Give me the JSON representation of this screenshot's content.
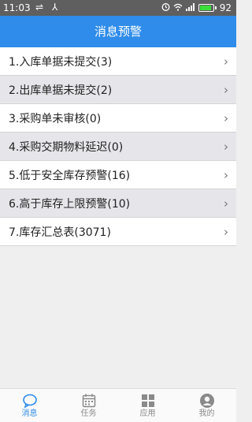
{
  "status_bar": {
    "time": "11:03",
    "battery_level": "92",
    "battery_fill": 0.92,
    "icons": [
      "usb-icon",
      "share-icon",
      "alarm-icon",
      "wifi-icon",
      "signal-icon",
      "battery-icon"
    ]
  },
  "header": {
    "title": "消息预警"
  },
  "messages": [
    "1.入库单据未提交(3)",
    "2.出库单据未提交(2)",
    "3.采购单未审核(0)",
    "4.采购交期物料延迟(0)",
    "5.低于安全库存预警(16)",
    "6.高于库存上限预警(10)",
    "7.库存汇总表(3071)"
  ],
  "tabs": [
    {
      "label": "消息",
      "icon": "message-icon",
      "active": true
    },
    {
      "label": "任务",
      "icon": "calendar-icon",
      "active": false
    },
    {
      "label": "应用",
      "icon": "grid-icon",
      "active": false
    },
    {
      "label": "我的",
      "icon": "user-icon",
      "active": false
    }
  ],
  "colors": {
    "accent": "#2f8cea",
    "status_bar": "#5f5f5f",
    "row_alt": "#e5e5ea",
    "tab_inactive": "#8a8a8a"
  }
}
